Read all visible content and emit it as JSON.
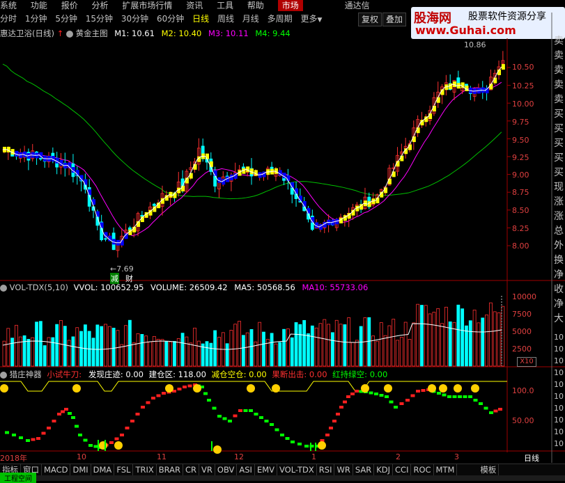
{
  "menu": {
    "items": [
      "系统",
      "功能",
      "报价",
      "分析",
      "扩展市场行情",
      "资讯",
      "工具",
      "帮助"
    ],
    "active": "市场",
    "right_text": "通达信"
  },
  "periods": {
    "items": [
      "分时",
      "1分钟",
      "5分钟",
      "15分钟",
      "30分钟",
      "60分钟",
      "日线",
      "周线",
      "月线",
      "多周期",
      "更多"
    ],
    "selected": "日线"
  },
  "toolbar": {
    "restore_label": "复权",
    "overlay_label": "叠加"
  },
  "watermark": {
    "brand": "股海网",
    "tagline": "股票软件资源分享",
    "url": "www.Guhai.com"
  },
  "main_panel": {
    "title": "惠达卫浴(日线)",
    "indicator": "黄金主图",
    "m1": "M1: 10.61",
    "m2": "M2: 10.40",
    "m3": "M3: 10.11",
    "m4": "M4: 9.44",
    "colors": {
      "m1": "#ffffff",
      "m2": "#ffff00",
      "m3": "#ff00ff",
      "m4": "#00ff00"
    },
    "high_label": "10.86",
    "low_label": "7.69",
    "buy_marker_1": "减",
    "buy_marker_2": "财",
    "y_ticks": [
      "10.50",
      "10.25",
      "10.00",
      "9.75",
      "9.50",
      "9.25",
      "9.00",
      "8.75",
      "8.50",
      "8.25",
      "8.00"
    ]
  },
  "vol_panel": {
    "name": "VOL-TDX(5,10)",
    "vvol": "VVOL: 100652.95",
    "volume": "VOLUME: 26509.42",
    "ma5": "MA5: 50568.56",
    "ma10": "MA10: 55733.06",
    "y_ticks": [
      "10000",
      "7500",
      "5000",
      "2500"
    ],
    "unit": "X10"
  },
  "sub_panel": {
    "name": "猎庄神器",
    "f1": "小试牛刀:",
    "f2": "发现庄迹: 0.00",
    "f3": "建仓区: 118.00",
    "f4": "减仓空仓: 0.00",
    "f5": "果断出击: 0.00",
    "f6": "红持绿空: 0.00",
    "y_ticks": [
      "100.0",
      "50.00"
    ]
  },
  "side_words": [
    "卖",
    "卖",
    "卖",
    "卖",
    "卖",
    "买",
    "买",
    "买",
    "买",
    "买",
    "现",
    "涨",
    "涨",
    "总",
    "外",
    "换",
    "净",
    "收",
    "净",
    "大"
  ],
  "right_edge_ticks": [
    "10",
    "10",
    "10",
    "10",
    "10",
    "10",
    "10",
    "10",
    "10",
    "10"
  ],
  "x_axis": {
    "labels": [
      "2018年",
      "10",
      "11",
      "12",
      "1",
      "2",
      "3"
    ],
    "right_label": "日线"
  },
  "bottom_tabs": [
    "指标",
    "窗口",
    "MACD",
    "DMI",
    "DMA",
    "FSL",
    "TRIX",
    "BRAR",
    "CR",
    "VR",
    "OBV",
    "ASI",
    "EMV",
    "VOL-TDX",
    "RSI",
    "WR",
    "SAR",
    "KDJ",
    "CCI",
    "ROC",
    "MTM",
    "模板"
  ],
  "status_text": "工程空间"
}
